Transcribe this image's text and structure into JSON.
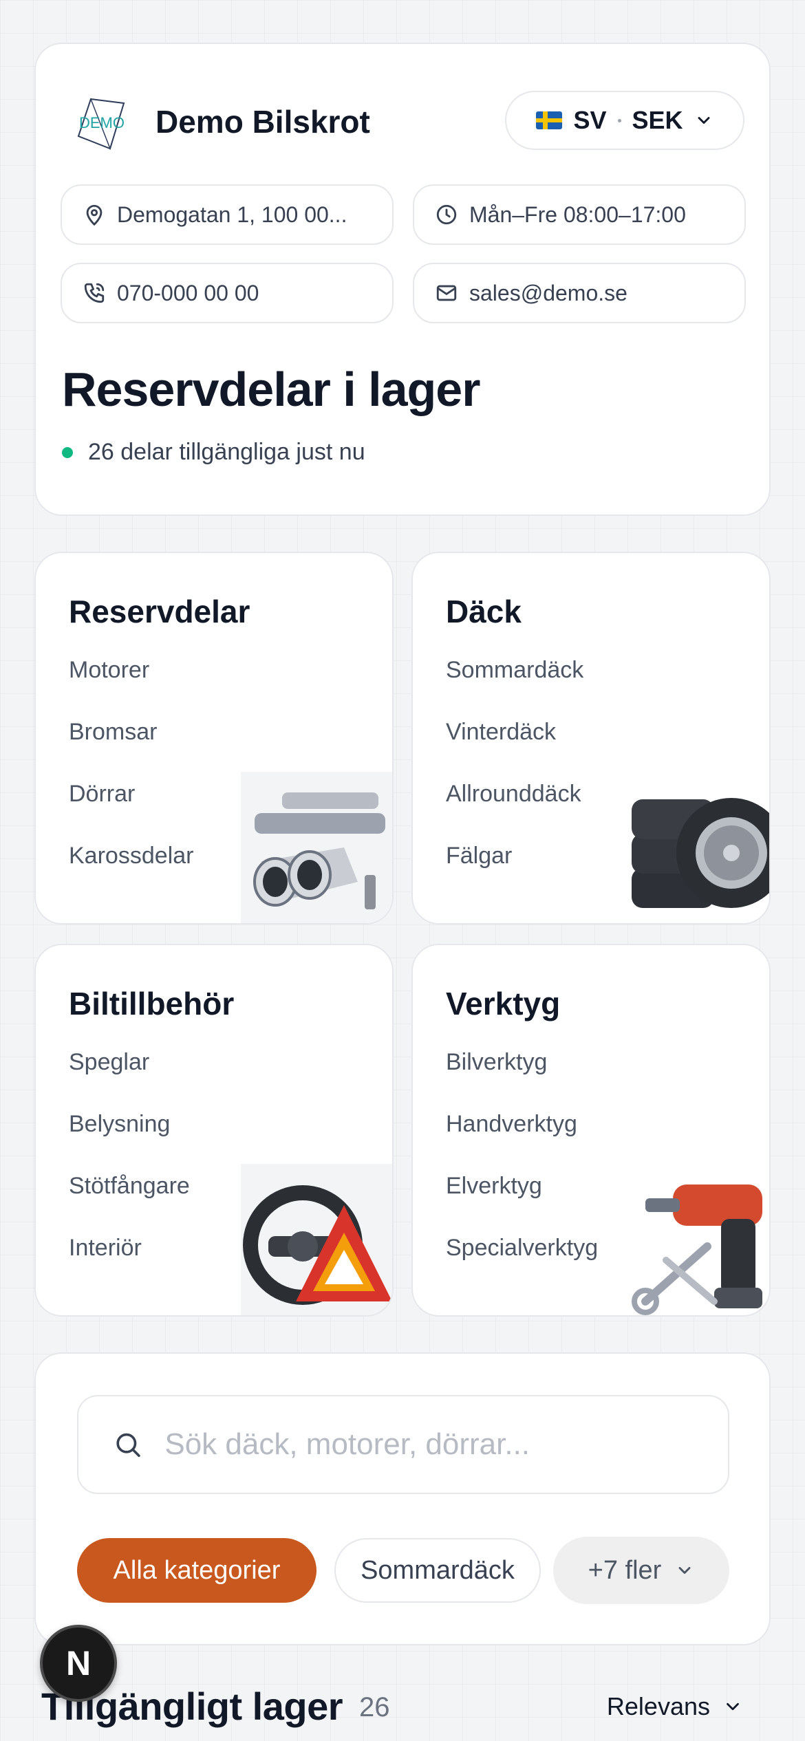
{
  "header": {
    "logo_text": "DEMO",
    "store_name": "Demo Bilskrot",
    "language": "SV",
    "currency": "SEK",
    "address": "Demogatan 1, 100 00...",
    "hours": "Mån–Fre 08:00–17:00",
    "phone": "070-000 00 00",
    "email": "sales@demo.se",
    "title": "Reservdelar i lager",
    "availability": "26 delar tillgängliga just nu"
  },
  "categories": [
    {
      "title": "Reservdelar",
      "items": [
        "Motorer",
        "Bromsar",
        "Dörrar",
        "Karossdelar"
      ],
      "icon": "exhaust-parts-icon"
    },
    {
      "title": "Däck",
      "items": [
        "Sommardäck",
        "Vinterdäck",
        "Allrounddäck",
        "Fälgar"
      ],
      "icon": "tires-icon"
    },
    {
      "title": "Biltillbehör",
      "items": [
        "Speglar",
        "Belysning",
        "Stötfångare",
        "Interiör"
      ],
      "icon": "steering-wheel-triangle-icon"
    },
    {
      "title": "Verktyg",
      "items": [
        "Bilverktyg",
        "Handverktyg",
        "Elverktyg",
        "Specialverktyg"
      ],
      "icon": "drill-tools-icon"
    }
  ],
  "search": {
    "placeholder": "Sök däck, motorer, dörrar...",
    "chips": {
      "active": "Alla kategorier",
      "second": "Sommardäck",
      "more": "+7 fler"
    }
  },
  "inventory": {
    "title": "Tillgängligt lager",
    "count": "26",
    "sort_label": "Relevans"
  },
  "badge": {
    "letter": "N"
  },
  "colors": {
    "accent": "#c8581e",
    "status_green": "#10b981",
    "text": "#111827"
  }
}
